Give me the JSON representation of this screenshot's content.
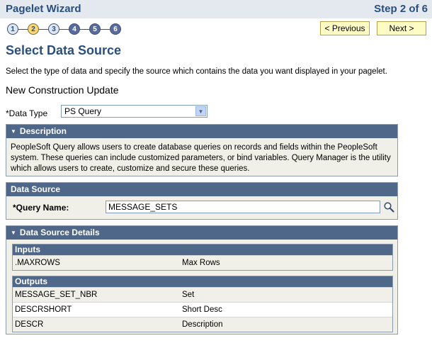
{
  "header": {
    "title": "Pagelet Wizard",
    "step_text": "Step 2 of 6"
  },
  "steps": [
    "1",
    "2",
    "3",
    "4",
    "5",
    "6"
  ],
  "current_step": 2,
  "buttons": {
    "previous": "< Previous",
    "next": "Next >"
  },
  "page": {
    "title": "Select Data Source",
    "instructions": "Select the type of data and specify the source which contains the data you want displayed in your pagelet.",
    "pagelet_name": "New Construction Update"
  },
  "data_type": {
    "label": "*Data Type",
    "value": "PS Query"
  },
  "description": {
    "header": "Description",
    "text": "PeopleSoft Query allows users to create database queries on records and fields within the PeopleSoft system. These queries can include customized parameters, or bind variables. Query Manager is the utility which allows users to create, customize and secure these queries."
  },
  "data_source": {
    "header": "Data Source",
    "query_label": "*Query Name:",
    "query_value": "MESSAGE_SETS"
  },
  "details": {
    "header": "Data Source Details",
    "inputs": {
      "header": "Inputs",
      "rows": [
        [
          ".MAXROWS",
          "Max Rows"
        ]
      ]
    },
    "outputs": {
      "header": "Outputs",
      "rows": [
        [
          "MESSAGE_SET_NBR",
          "Set"
        ],
        [
          "DESCRSHORT",
          "Short Desc"
        ],
        [
          "DESCR",
          "Description"
        ]
      ]
    }
  }
}
